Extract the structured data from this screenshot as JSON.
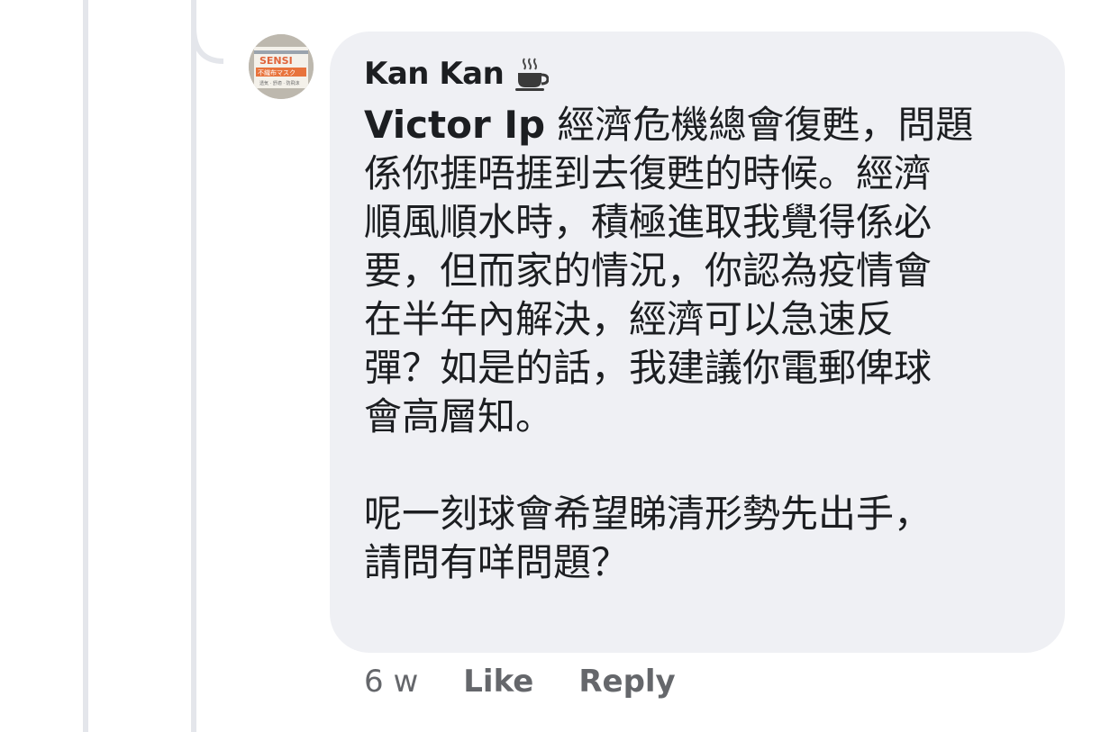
{
  "comment": {
    "author": "Kan Kan",
    "author_badge_icon": "coffee-icon",
    "avatar_text": {
      "brand": "SENSI",
      "line2": "不織布マスク",
      "line3": "透気 · 舒適 · 防飛沫"
    },
    "mention": "Victor Ip",
    "line_1_after_mention": " 經濟危機總會復甦，問題",
    "lines": [
      "係你捱唔捱到去復甦的時候。經濟",
      "順風順水時，積極進取我覺得係必",
      "要，但而家的情況，你認為疫情會",
      "在半年內解決，經濟可以急速反",
      "彈？如是的話，我建議你電郵俾球",
      "會高層知。"
    ],
    "paragraph_2": [
      "呢一刻球會希望睇清形勢先出手，",
      "請問有咩問題？"
    ]
  },
  "actions": {
    "timestamp": "6 w",
    "like_label": "Like",
    "reply_label": "Reply"
  },
  "colors": {
    "bubble": "#eff0f4",
    "text_primary": "#1c1e21",
    "text_secondary": "#65676b",
    "thread_line": "#e4e6eb"
  }
}
